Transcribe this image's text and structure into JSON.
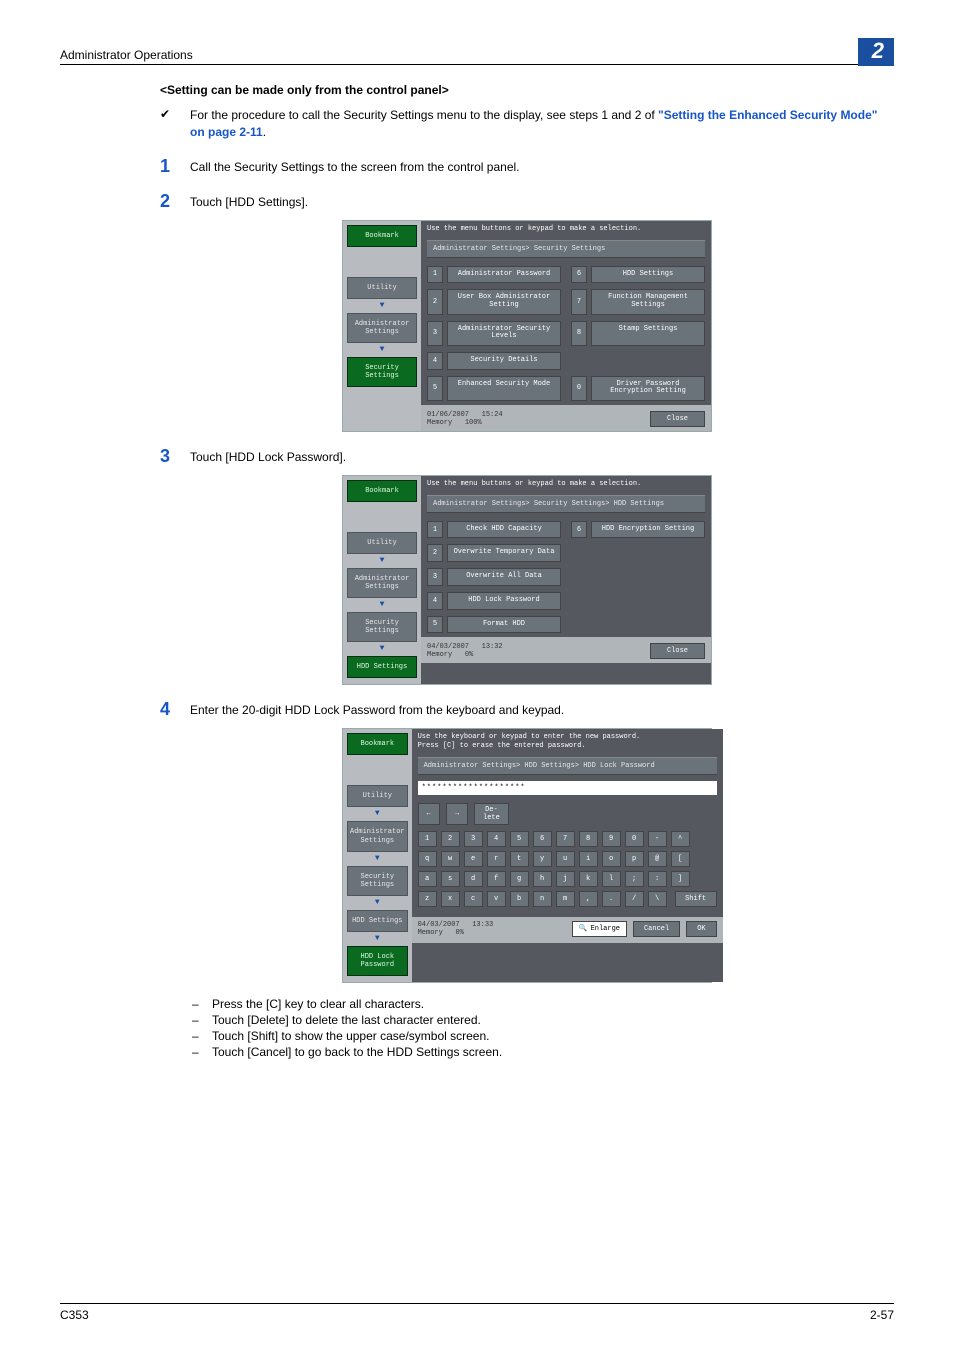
{
  "header": {
    "title": "Administrator Operations",
    "chapter": "2"
  },
  "subhead": "<Setting can be made only from the control panel>",
  "intro": {
    "check": "✔",
    "text_a": "For the procedure to call the Security Settings menu to the display, see steps 1 and 2 of ",
    "link": "\"Setting the Enhanced Security Mode\" on page 2-11",
    "text_b": "."
  },
  "steps": {
    "s1": {
      "num": "1",
      "text": "Call the Security Settings to the screen from the control panel."
    },
    "s2": {
      "num": "2",
      "text": "Touch [HDD Settings]."
    },
    "s3": {
      "num": "3",
      "text": "Touch [HDD Lock Password]."
    },
    "s4": {
      "num": "4",
      "text": "Enter the 20-digit HDD Lock Password from the keyboard and keypad."
    }
  },
  "sub": {
    "a": "Press the [C] key to clear all characters.",
    "b": "Touch [Delete] to delete the last character entered.",
    "c": "Touch [Shift] to show the upper case/symbol screen.",
    "d": "Touch [Cancel] to go back to the HDD Settings screen."
  },
  "footer": {
    "left": "C353",
    "right": "2-57"
  },
  "screen1": {
    "instr": "Use the menu buttons or keypad to make a selection.",
    "breadcrumb": "Administrator Settings> Security Settings",
    "nav": {
      "bookmark": "Bookmark",
      "utility": "Utility",
      "admin": "Administrator\nSettings",
      "security": "Security\nSettings"
    },
    "opts": {
      "o1": "Administrator Password",
      "o2": "User Box Administrator\nSetting",
      "o3": "Administrator Security\nLevels",
      "o4": "Security Details",
      "o5": "Enhanced Security Mode",
      "o6": "HDD Settings",
      "o7": "Function Management Settings",
      "o8": "Stamp Settings",
      "o0": "Driver Password\nEncryption Setting"
    },
    "status": {
      "date": "01/06/2007",
      "time": "15:24",
      "mem": "Memory",
      "memv": "100%"
    },
    "close": "Close"
  },
  "screen2": {
    "instr": "Use the menu buttons or keypad to make a selection.",
    "breadcrumb": "Administrator Settings> Security Settings> HDD Settings",
    "nav": {
      "bookmark": "Bookmark",
      "utility": "Utility",
      "admin": "Administrator\nSettings",
      "security": "Security\nSettings",
      "hdd": "HDD Settings"
    },
    "opts": {
      "o1": "Check HDD Capacity",
      "o2": "Overwrite Temporary Data",
      "o3": "Overwrite All Data",
      "o4": "HDD Lock Password",
      "o5": "Format HDD",
      "o6": "HDD Encryption Setting"
    },
    "status": {
      "date": "04/03/2007",
      "time": "13:32",
      "mem": "Memory",
      "memv": "0%"
    },
    "close": "Close"
  },
  "screen3": {
    "instr": "Use the keyboard or keypad to enter the new password.\nPress [C] to erase the entered password.",
    "breadcrumb": "Administrator Settings> HDD Settings> HDD Lock Password",
    "nav": {
      "bookmark": "Bookmark",
      "utility": "Utility",
      "admin": "Administrator\nSettings",
      "security": "Security\nSettings",
      "hdd": "HDD Settings",
      "hddlock": "HDD Lock\nPassword"
    },
    "pw": "********************",
    "tool": {
      "left": "←",
      "right": "→",
      "del": "De-\nlete"
    },
    "row1": [
      "1",
      "2",
      "3",
      "4",
      "5",
      "6",
      "7",
      "8",
      "9",
      "0",
      "-",
      "^"
    ],
    "row2": [
      "q",
      "w",
      "e",
      "r",
      "t",
      "y",
      "u",
      "i",
      "o",
      "p",
      "@",
      "["
    ],
    "row3": [
      "a",
      "s",
      "d",
      "f",
      "g",
      "h",
      "j",
      "k",
      "l",
      ";",
      ":",
      "]"
    ],
    "row4": [
      "z",
      "x",
      "c",
      "v",
      "b",
      "n",
      "m",
      ",",
      ".",
      "/",
      "\\"
    ],
    "shift": "Shift",
    "status": {
      "date": "04/03/2007",
      "time": "13:33",
      "mem": "Memory",
      "memv": "0%"
    },
    "enlarge": "Enlarge",
    "cancel": "Cancel",
    "ok": "OK"
  }
}
